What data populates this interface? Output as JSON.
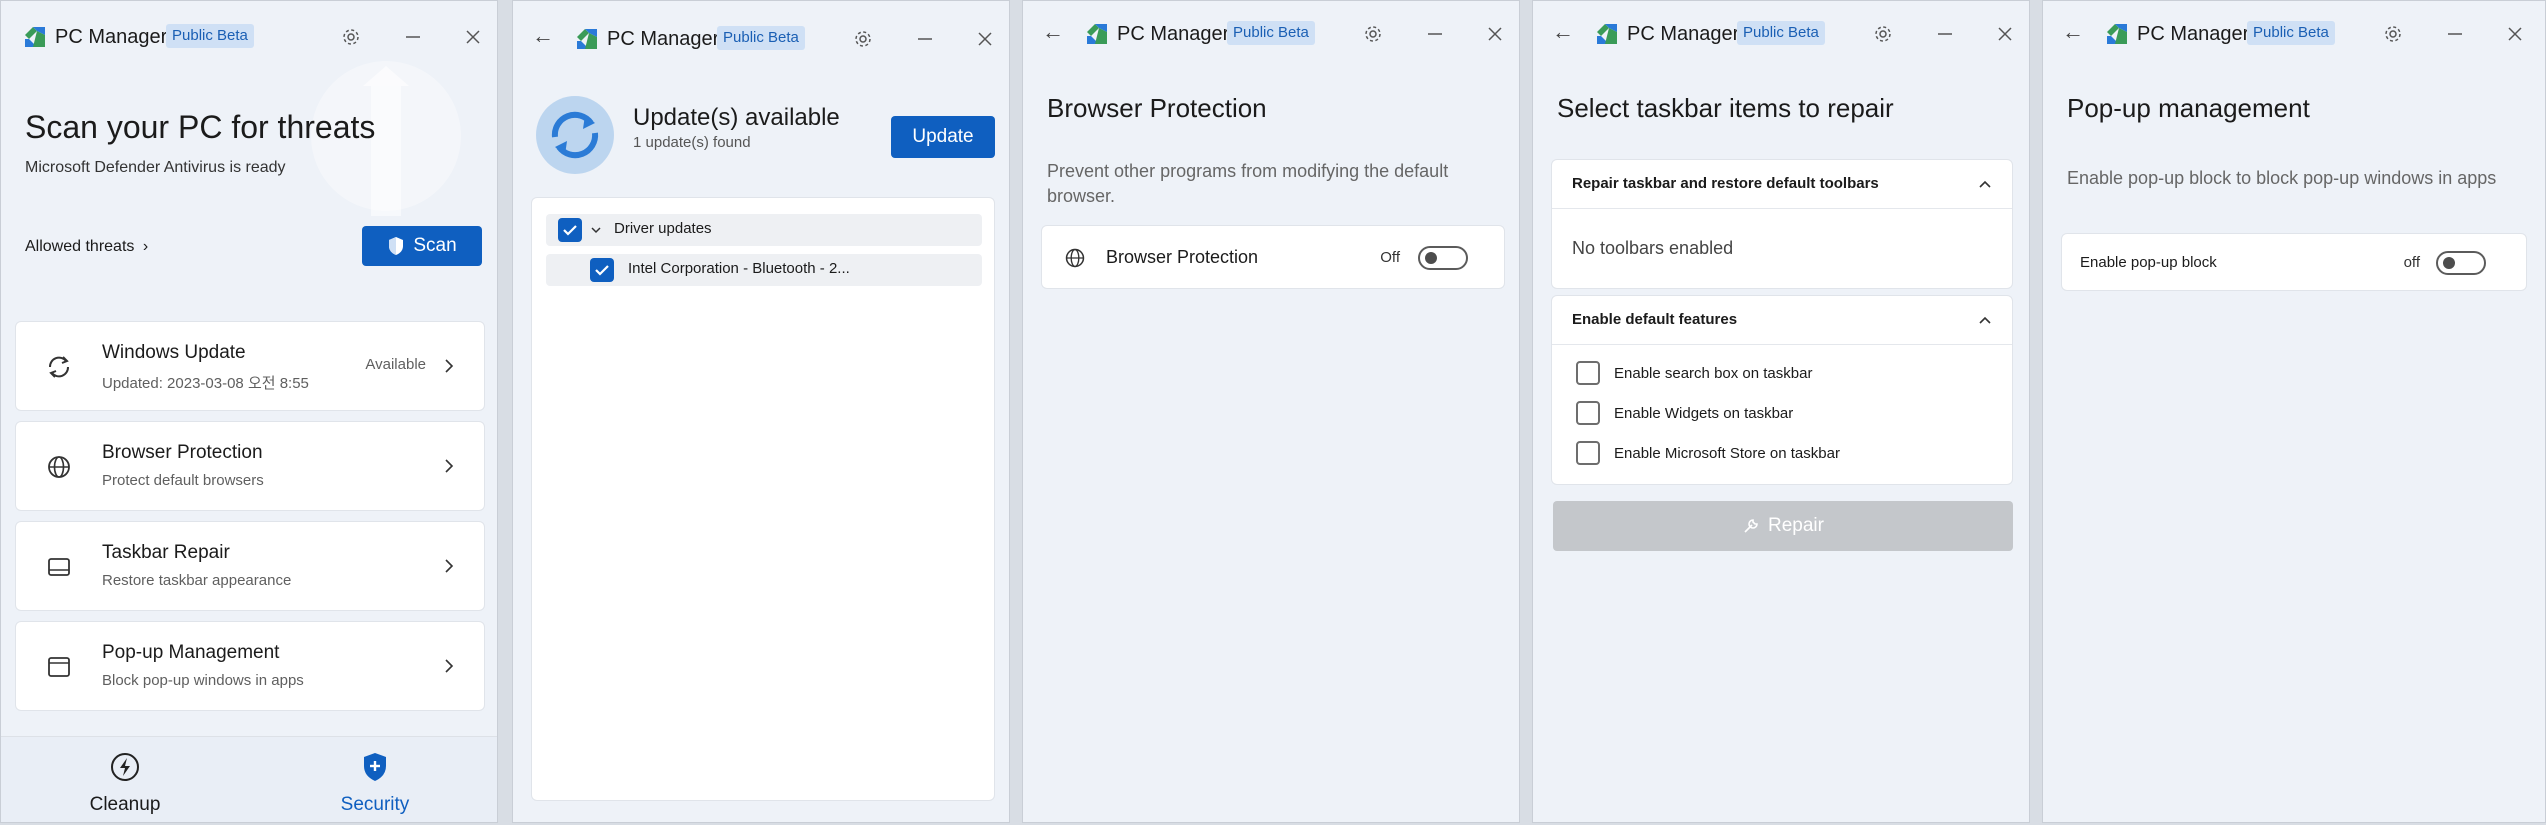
{
  "app": {
    "title": "PC Manager",
    "badge": "Public Beta"
  },
  "w1": {
    "heading": "Scan your PC for threats",
    "subheading": "Microsoft Defender Antivirus is ready",
    "allowed_threats": "Allowed threats",
    "scan_label": "Scan",
    "items": [
      {
        "title": "Windows Update",
        "sub": "Updated: 2023-03-08 오전 8:55",
        "status": "Available"
      },
      {
        "title": "Browser Protection",
        "sub": "Protect default browsers"
      },
      {
        "title": "Taskbar Repair",
        "sub": "Restore taskbar appearance"
      },
      {
        "title": "Pop-up Management",
        "sub": "Block pop-up windows in apps"
      }
    ],
    "nav": {
      "cleanup": "Cleanup",
      "security": "Security"
    }
  },
  "w2": {
    "heading": "Update(s) available",
    "found": "1 update(s) found",
    "update_label": "Update",
    "group": "Driver updates",
    "item": "Intel Corporation - Bluetooth - 2..."
  },
  "w3": {
    "heading": "Browser Protection",
    "desc": "Prevent other programs from modifying the default browser.",
    "row_label": "Browser Protection",
    "state": "Off"
  },
  "w4": {
    "heading": "Select taskbar items to repair",
    "sec1": "Repair taskbar and restore default toolbars",
    "sec1_empty": "No toolbars enabled",
    "sec2": "Enable default features",
    "options": [
      "Enable search box on taskbar",
      "Enable Widgets on taskbar",
      "Enable Microsoft Store on taskbar"
    ],
    "repair_label": "Repair"
  },
  "w5": {
    "heading": "Pop-up management",
    "desc": "Enable pop-up block to block pop-up windows in apps",
    "row_label": "Enable pop-up block",
    "state": "off"
  },
  "colors": {
    "accent": "#0f5fc0",
    "badge_bg": "#cfe0f5",
    "window_bg": "#eef2f8",
    "disabled_btn": "#c4c7cb"
  }
}
